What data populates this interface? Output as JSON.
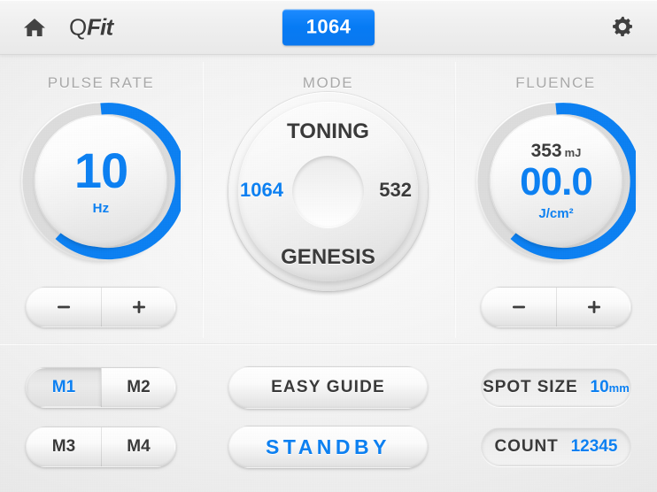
{
  "header": {
    "home_icon": "home-icon",
    "brand_q": "Q",
    "brand_fit": "Fit",
    "wavelength_badge": "1064",
    "gear_icon": "gear-icon"
  },
  "colors": {
    "accent_blue": "#0c80f2",
    "badge_blue": "#067bf4",
    "text_dark": "#3a3a3a",
    "label_gray": "#a9a9a9",
    "panel_bg": "#f2f2f2"
  },
  "pulse_rate": {
    "label": "PULSE RATE",
    "value": "10",
    "unit": "Hz",
    "arc_percent": 60,
    "minus_label": "−",
    "plus_label": "+"
  },
  "mode": {
    "label": "MODE",
    "options": [
      {
        "name": "toning",
        "label": "TONING",
        "active": false
      },
      {
        "name": "1064",
        "label": "1064",
        "active": true
      },
      {
        "name": "532",
        "label": "532",
        "active": false
      },
      {
        "name": "genesis",
        "label": "GENESIS",
        "active": false
      }
    ],
    "selected": "1064"
  },
  "fluence": {
    "label": "FLUENCE",
    "energy_value": "353",
    "energy_unit": "mJ",
    "value": "00.0",
    "unit": "J/cm²",
    "arc_percent": 60,
    "minus_label": "−",
    "plus_label": "+"
  },
  "memory": {
    "row1": [
      {
        "label": "M1",
        "selected": true
      },
      {
        "label": "M2",
        "selected": false
      }
    ],
    "row2": [
      {
        "label": "M3",
        "selected": false
      },
      {
        "label": "M4",
        "selected": false
      }
    ]
  },
  "actions": {
    "easy_guide": "EASY GUIDE",
    "standby": "STANDBY"
  },
  "info": {
    "spot_size_label": "SPOT SIZE",
    "spot_size_value": "10",
    "spot_size_unit": "mm",
    "count_label": "COUNT",
    "count_value": "12345"
  }
}
